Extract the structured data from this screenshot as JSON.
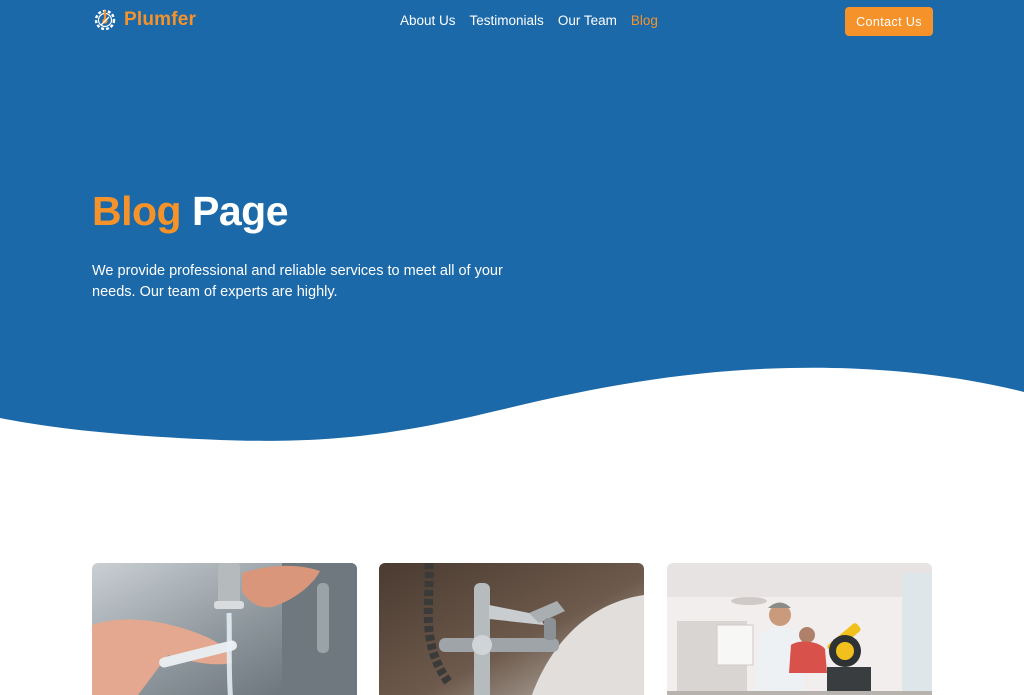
{
  "brand": {
    "name": "Plumfer",
    "logo_icon": "gear-wrench-icon"
  },
  "nav": {
    "items": [
      {
        "label": "About Us",
        "active": false
      },
      {
        "label": "Testimonials",
        "active": false
      },
      {
        "label": "Our Team",
        "active": false
      },
      {
        "label": "Blog",
        "active": true
      }
    ],
    "cta_label": "Contact Us"
  },
  "hero": {
    "title_accent": "Blog",
    "title_main": "Page",
    "description": "We provide professional and reliable services to meet all of your needs. Our team of experts are highly."
  },
  "blog_cards": [
    {
      "image": "plumber-hands-faucet-photo"
    },
    {
      "image": "chrome-bath-faucet-photo"
    },
    {
      "image": "worker-with-miter-saw-photo"
    }
  ],
  "colors": {
    "primary_blue": "#1b69a8",
    "accent_orange": "#f5932a",
    "white": "#ffffff"
  }
}
